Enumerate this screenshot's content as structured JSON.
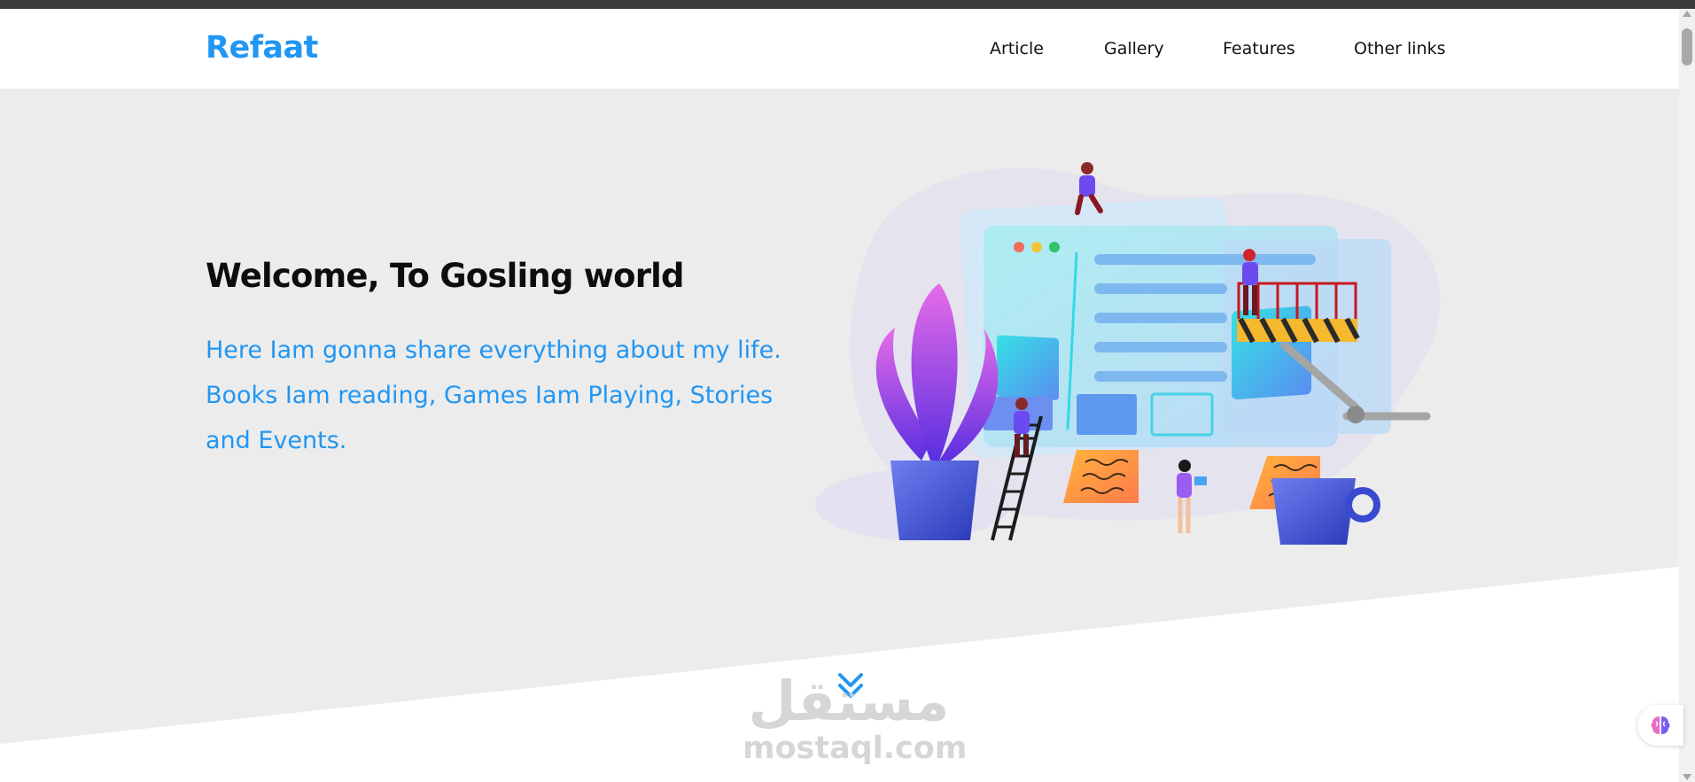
{
  "header": {
    "logo": "Refaat",
    "nav": [
      "Article",
      "Gallery",
      "Features",
      "Other links"
    ]
  },
  "hero": {
    "title": "Welcome, To Gosling world",
    "paragraph": "Here Iam gonna share everything about my life. Books Iam reading, Games Iam Playing, Stories and Events."
  },
  "watermark": {
    "arabic": "مستقل",
    "latin": "mostaql.com"
  },
  "colors": {
    "accent": "#2196f3",
    "hero_bg": "#ececec",
    "heading": "#0d0d0d"
  },
  "icons": {
    "scroll_down": "chevrons-down-icon",
    "extension": "brain-icon"
  }
}
